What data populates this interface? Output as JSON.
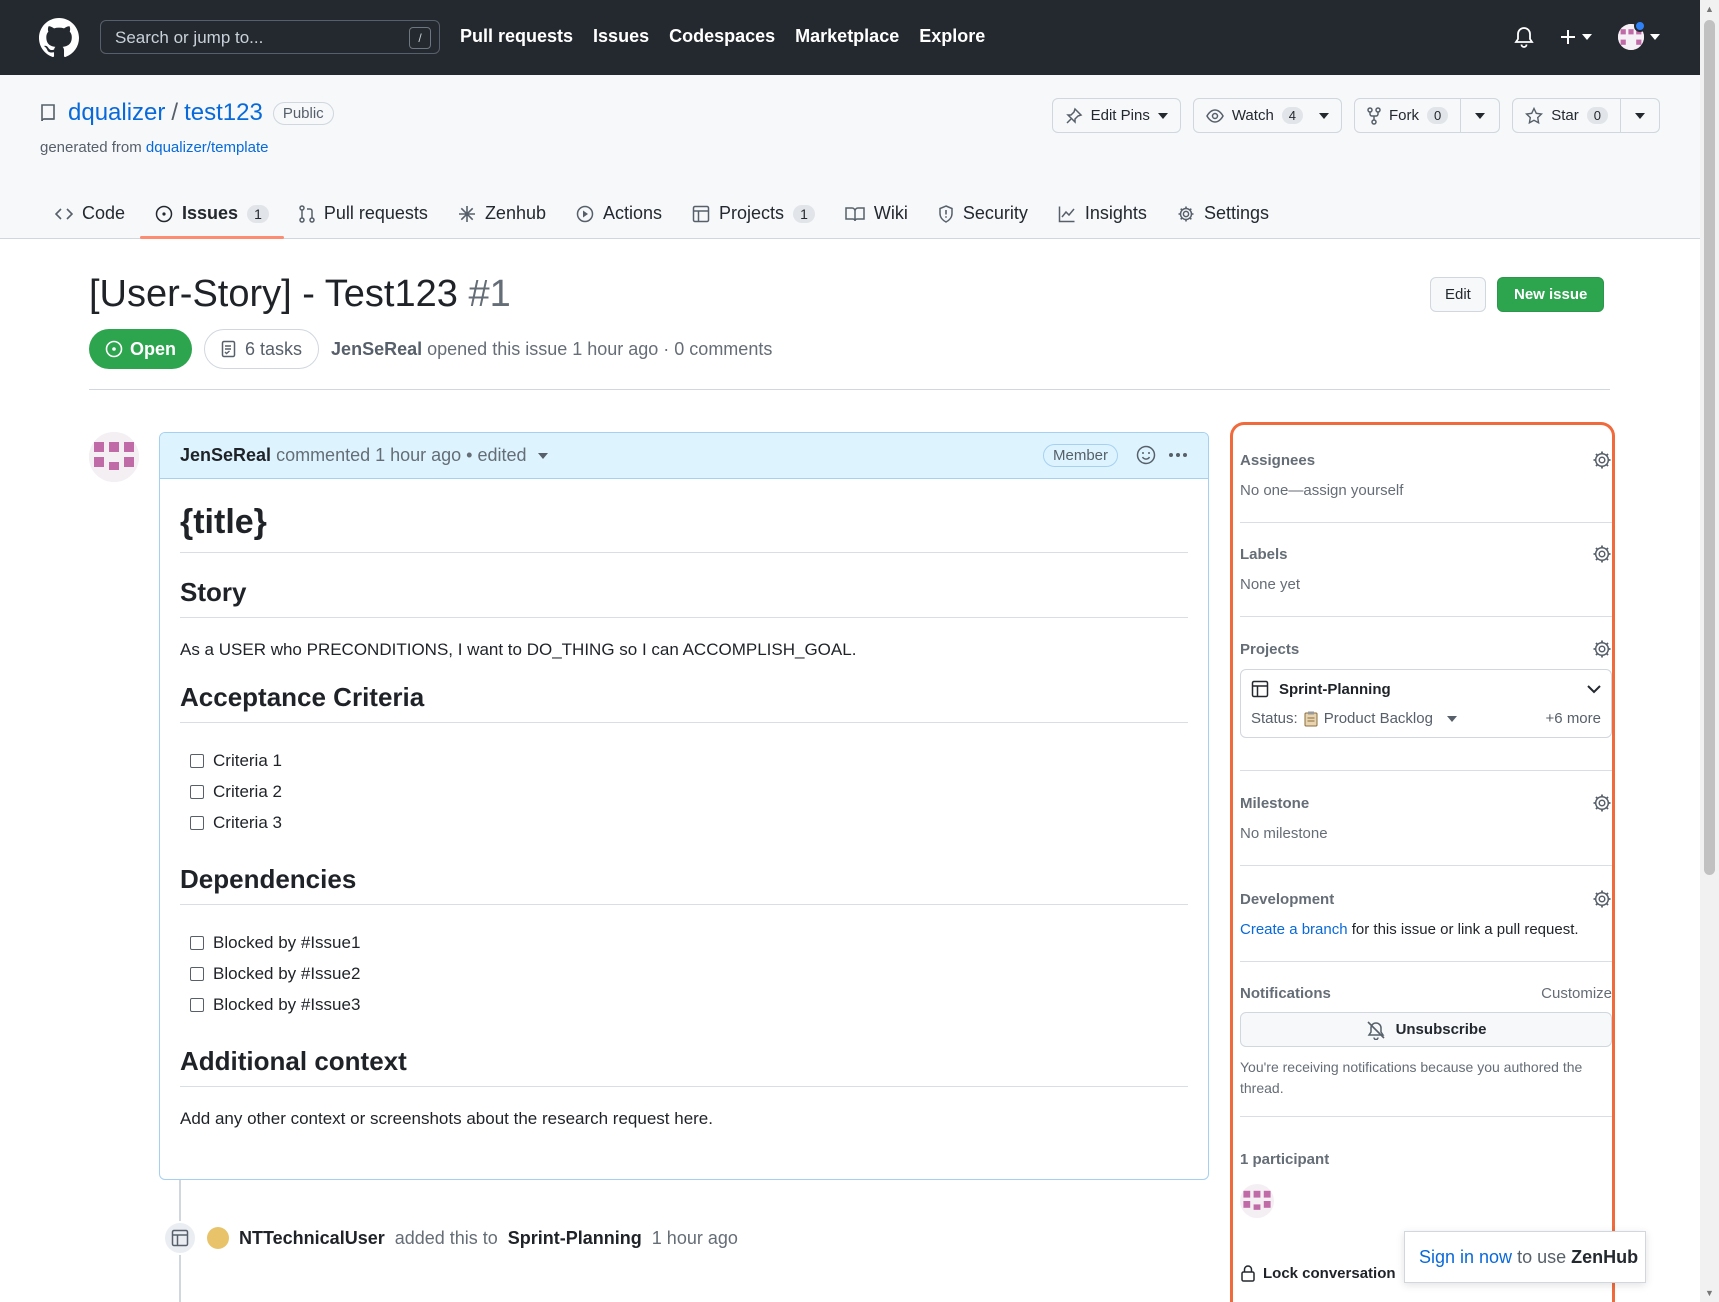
{
  "header": {
    "search_placeholder": "Search or jump to...",
    "search_shortcut": "/",
    "nav": [
      "Pull requests",
      "Issues",
      "Codespaces",
      "Marketplace",
      "Explore"
    ]
  },
  "repo": {
    "owner": "dqualizer",
    "name": "test123",
    "visibility": "Public",
    "generated_label": "generated from",
    "generated_link": "dqualizer/template",
    "edit_pins": "Edit Pins",
    "watch": "Watch",
    "watch_count": "4",
    "fork": "Fork",
    "fork_count": "0",
    "star": "Star",
    "star_count": "0"
  },
  "tabs": [
    {
      "label": "Code",
      "icon": "code-icon"
    },
    {
      "label": "Issues",
      "count": "1",
      "icon": "issue-opened-icon"
    },
    {
      "label": "Pull requests",
      "icon": "git-pull-request-icon"
    },
    {
      "label": "Zenhub",
      "icon": "zenhub-icon"
    },
    {
      "label": "Actions",
      "icon": "play-icon"
    },
    {
      "label": "Projects",
      "count": "1",
      "icon": "table-icon"
    },
    {
      "label": "Wiki",
      "icon": "book-icon"
    },
    {
      "label": "Security",
      "icon": "shield-icon"
    },
    {
      "label": "Insights",
      "icon": "graph-icon"
    },
    {
      "label": "Settings",
      "icon": "gear-icon"
    }
  ],
  "issue": {
    "title": "[User-Story] - Test123",
    "number": "#1",
    "edit": "Edit",
    "new_issue": "New issue",
    "state": "Open",
    "tasks": "6 tasks",
    "author": "JenSeReal",
    "opened_text": "opened this issue 1 hour ago · 0 comments"
  },
  "comment": {
    "author": "JenSeReal",
    "meta": "commented 1 hour ago • edited",
    "role": "Member",
    "h1": "{title}",
    "story_heading": "Story",
    "story_text": "As a USER who PRECONDITIONS, I want to DO_THING so I can ACCOMPLISH_GOAL.",
    "acceptance_heading": "Acceptance Criteria",
    "acceptance": [
      "Criteria 1",
      "Criteria 2",
      "Criteria 3"
    ],
    "dependencies_heading": "Dependencies",
    "dependencies": [
      "Blocked by #Issue1",
      "Blocked by #Issue2",
      "Blocked by #Issue3"
    ],
    "context_heading": "Additional context",
    "context_text": "Add any other context or screenshots about the research request here."
  },
  "timeline": {
    "actor": "NTTechnicalUser",
    "action": "added this to",
    "target": "Sprint-Planning",
    "time": "1 hour ago"
  },
  "sidebar": {
    "assignees": {
      "label": "Assignees",
      "value": "No one—assign yourself"
    },
    "labels": {
      "label": "Labels",
      "value": "None yet"
    },
    "projects": {
      "label": "Projects",
      "project": "Sprint-Planning",
      "status_label": "Status:",
      "status_value": "Product Backlog",
      "more": "+6 more"
    },
    "milestone": {
      "label": "Milestone",
      "value": "No milestone"
    },
    "development": {
      "label": "Development",
      "link": "Create a branch",
      "rest": "for this issue or link a pull request."
    },
    "notifications": {
      "label": "Notifications",
      "customize": "Customize",
      "button": "Unsubscribe",
      "reason": "You're receiving notifications because you authored the thread."
    },
    "participants": {
      "label": "1 participant"
    },
    "lock": "Lock conversation"
  },
  "zenhub_toast": {
    "link": "Sign in now",
    "text": "to use",
    "brand": "ZenHub"
  }
}
